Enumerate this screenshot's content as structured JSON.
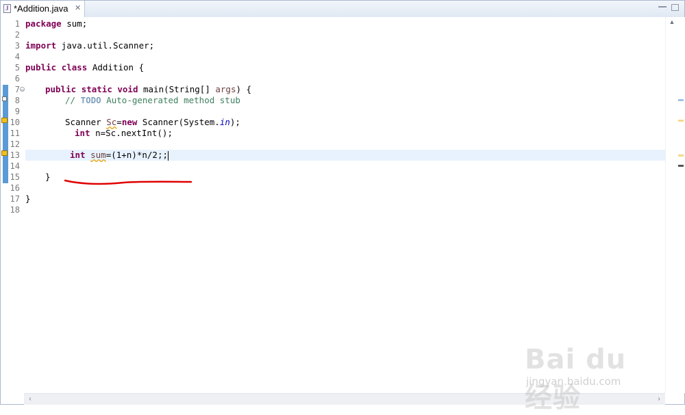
{
  "tab": {
    "title": "*Addition.java",
    "close": "✕"
  },
  "line_numbers": [
    "1",
    "2",
    "3",
    "4",
    "5",
    "6",
    "7",
    "8",
    "9",
    "10",
    "11",
    "12",
    "13",
    "14",
    "15",
    "16",
    "17",
    "18"
  ],
  "code": {
    "l1": {
      "kw": "package",
      "rest": " sum;"
    },
    "l3": {
      "kw": "import",
      "rest": " java.util.Scanner;"
    },
    "l5": {
      "kw1": "public",
      "kw2": "class",
      "rest": " Addition {"
    },
    "l7": {
      "kw1": "public",
      "kw2": "static",
      "kw3": "void",
      "rest": " main(String[] ",
      "arg": "args",
      "end": ") {"
    },
    "l8": {
      "prefix": "// ",
      "todo": "TODO",
      "rest": " Auto-generated method stub"
    },
    "l10": {
      "a": "Scanner ",
      "var": "Sc",
      "b": "=",
      "kw": "new",
      "c": " Scanner(System.",
      "fld": "in",
      "d": ");"
    },
    "l11": {
      "kw": "int",
      "rest": " n=Sc.nextInt();"
    },
    "l13": {
      "kw": "int",
      "sp": " ",
      "var": "sum",
      "rest": "=(1+n)*n/2;;"
    },
    "l15": {
      "text": "}"
    },
    "l17": {
      "text": "}"
    }
  },
  "watermark": {
    "brand": "Bai du 经验",
    "url": "jingyan.baidu.com"
  },
  "colors": {
    "keyword": "#7f0055",
    "comment": "#3f7f5f",
    "todo": "#7f9fbf",
    "field": "#0000c0",
    "current_line": "#e8f2fe",
    "annotation": "#e00000"
  }
}
